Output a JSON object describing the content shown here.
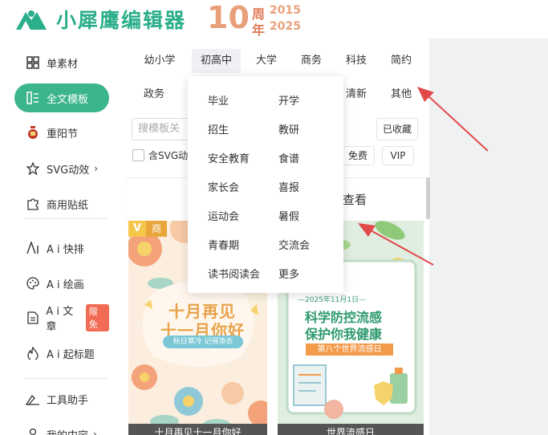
{
  "brand": {
    "logo_text": "小犀鹰编辑器",
    "anniv_number": "10",
    "anniv_zhou": "周",
    "anniv_year1": "2015",
    "anniv_nian": "年",
    "anniv_year2": "2025",
    "accent": "#3bb58e"
  },
  "sidebar": {
    "items": [
      {
        "label": "单素材",
        "icon": "grid-icon"
      },
      {
        "label": "全文模板",
        "icon": "template-icon",
        "active": true
      },
      {
        "label": "重阳节",
        "icon": "wine-jar-icon"
      },
      {
        "label": "SVG动效",
        "icon": "star-outline-icon",
        "arrow": "›"
      },
      {
        "label": "商用贴纸",
        "icon": "puzzle-icon"
      },
      {
        "label": "A i 快排",
        "icon": "ai-text-icon"
      },
      {
        "label": "A i 绘画",
        "icon": "palette-icon"
      },
      {
        "label": "A i 文章",
        "icon": "document-icon",
        "badge": "限免"
      },
      {
        "label": "A i 起标题",
        "icon": "flame-icon"
      },
      {
        "label": "工具助手",
        "icon": "tools-icon"
      },
      {
        "label": "我的内容",
        "icon": "user-icon",
        "arrow": "›"
      }
    ]
  },
  "categories": {
    "row1": [
      "幼小学",
      "初高中",
      "大学",
      "商务",
      "科技",
      "简约"
    ],
    "row2_left": "政务",
    "row2_right": [
      "清新",
      "其他"
    ],
    "active": "初高中"
  },
  "dropdown": {
    "left": [
      "毕业",
      "招生",
      "安全教育",
      "家长会",
      "运动会",
      "青春期",
      "读书阅读会"
    ],
    "right": [
      "开学",
      "教研",
      "食谱",
      "喜报",
      "暑假",
      "交流会",
      "更多"
    ]
  },
  "filters": {
    "search_placeholder": "搜模板关",
    "collected": "已收藏",
    "svg_checkbox": "含SVG动",
    "free": "免费",
    "vip": "VIP"
  },
  "view_bar": {
    "left_partial": "查",
    "text": "查看"
  },
  "cards": {
    "card1": {
      "badge_v": "V",
      "badge_shang": "商",
      "title1": "十月再见",
      "title2": "十一月你好",
      "subtitle": "秋日寒冷 记得添衣",
      "footer": "十月再见十一月你好"
    },
    "card2": {
      "date": "—2025年11月1日—",
      "title1": "科学防控流感",
      "title2": "保护你我健康",
      "band": "第八个世界流感日",
      "footer": "世界流感日"
    }
  }
}
